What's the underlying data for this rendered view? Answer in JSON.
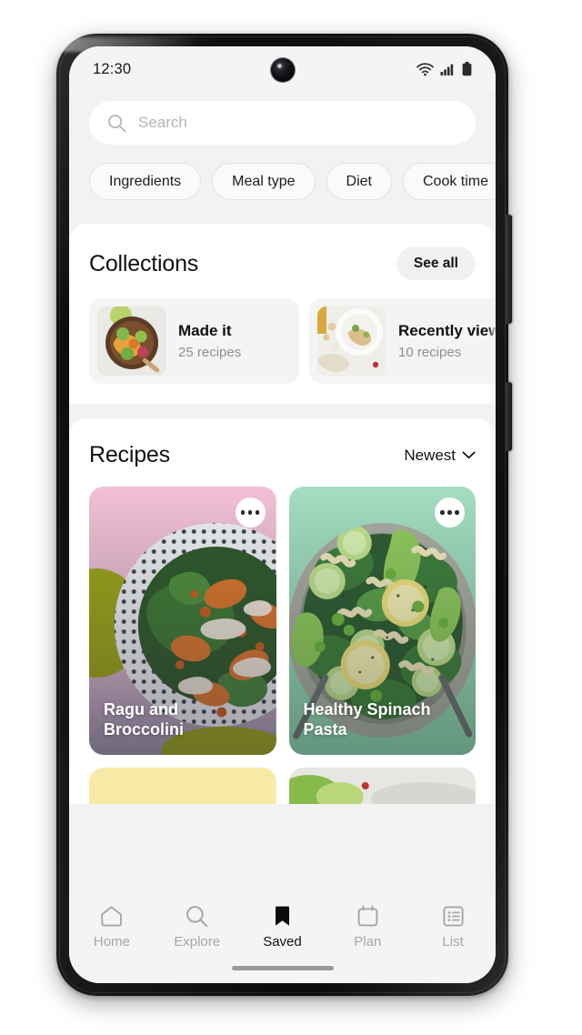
{
  "status_bar": {
    "time": "12:30",
    "icons": [
      "wifi-icon",
      "cellular-signal-icon",
      "battery-icon"
    ]
  },
  "search": {
    "placeholder": "Search",
    "icon": "search-icon"
  },
  "filters": {
    "chips": [
      {
        "label": "Ingredients"
      },
      {
        "label": "Meal type"
      },
      {
        "label": "Diet"
      },
      {
        "label": "Cook time"
      }
    ]
  },
  "collections": {
    "title": "Collections",
    "see_all_label": "See all",
    "items": [
      {
        "name": "Made it",
        "count": "25 recipes"
      },
      {
        "name": "Recently viewed",
        "count": "10 recipes"
      }
    ]
  },
  "recipes": {
    "title": "Recipes",
    "sort_label": "Newest",
    "sort_icon": "chevron-down-icon",
    "menu_icon": "more-options-icon",
    "items": [
      {
        "title": "Ragu and Broccolini",
        "bg": "#f0bdd4"
      },
      {
        "title": "Healthy Spinach Pasta",
        "bg": "#9ed9be"
      },
      {
        "title": "",
        "bg": "#f7eaa6"
      },
      {
        "title": "",
        "bg": "#cfe3c3"
      }
    ]
  },
  "fab": {
    "icon": "plus-icon",
    "color": "#f59130"
  },
  "bottom_nav": {
    "items": [
      {
        "label": "Home",
        "icon": "home-icon",
        "active": false
      },
      {
        "label": "Explore",
        "icon": "search-icon",
        "active": false
      },
      {
        "label": "Saved",
        "icon": "bookmark-icon",
        "active": true
      },
      {
        "label": "Plan",
        "icon": "calendar-icon",
        "active": false
      },
      {
        "label": "List",
        "icon": "list-icon",
        "active": false
      }
    ]
  }
}
